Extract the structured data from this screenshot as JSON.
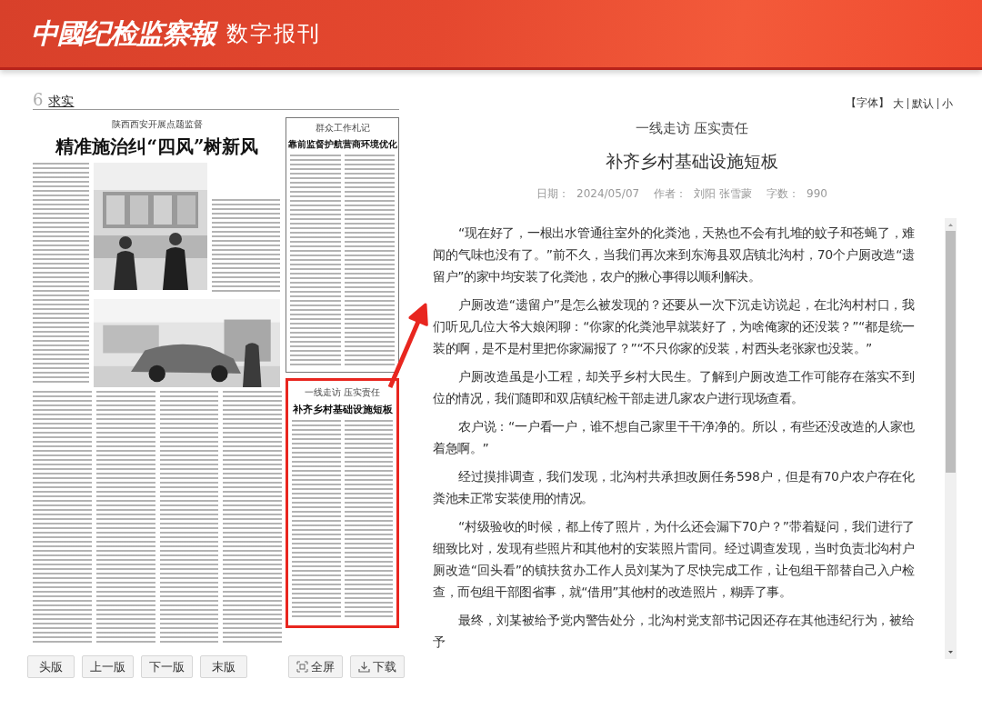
{
  "header": {
    "logo": "中國纪检监察報",
    "subtitle": "数字报刊"
  },
  "newspaper": {
    "page_number": "6",
    "section": "求实",
    "articles": [
      {
        "kicker": "陕西西安开展点题监督",
        "headline": "精准施治纠“四风”树新风",
        "highlighted": false
      },
      {
        "kicker": "群众工作札记",
        "headline": "靠前监督护航营商环境优化",
        "highlighted": false
      },
      {
        "kicker": "一线走访 压实责任",
        "headline": "补齐乡村基础设施短板",
        "highlighted": true
      }
    ]
  },
  "page_nav": [
    "头版",
    "上一版",
    "下一版",
    "末版"
  ],
  "tools": [
    {
      "kind": "fullscreen",
      "label": "全屏"
    },
    {
      "kind": "download",
      "label": "下载"
    }
  ],
  "font_size": {
    "label": "【字体】",
    "options": [
      "大",
      "默认",
      "小"
    ]
  },
  "article": {
    "kicker": "一线走访 压实责任",
    "title": "补齐乡村基础设施短板",
    "meta": [
      {
        "label": "日期：",
        "value": "2024/05/07"
      },
      {
        "label": "作者：",
        "value": "刘阳 张雪蒙"
      },
      {
        "label": "字数：",
        "value": "990"
      }
    ],
    "paragraphs": [
      "“现在好了，一根出水管通往室外的化粪池，天热也不会有扎堆的蚊子和苍蝇了，难闻的气味也没有了。”前不久，当我们再次来到东海县双店镇北沟村，70个户厕改造“遗留户”的家中均安装了化粪池，农户的揪心事得以顺利解决。",
      "户厕改造“遗留户”是怎么被发现的？还要从一次下沉走访说起，在北沟村村口，我们听见几位大爷大娘闲聊：“你家的化粪池早就装好了，为啥俺家的还没装？”“都是统一装的啊，是不是村里把你家漏报了？”“不只你家的没装，村西头老张家也没装。”",
      "户厕改造虽是小工程，却关乎乡村大民生。了解到户厕改造工作可能存在落实不到位的情况，我们随即和双店镇纪检干部走进几家农户进行现场查看。",
      "农户说：“一户看一户，谁不想自己家里干干净净的。所以，有些还没改造的人家也着急啊。”",
      "经过摸排调查，我们发现，北沟村共承担改厕任务598户，但是有70户农户存在化粪池未正常安装使用的情况。",
      "“村级验收的时候，都上传了照片，为什么还会漏下70户？”带着疑问，我们进行了细致比对，发现有些照片和其他村的安装照片雷同。经过调查发现，当时负责北沟村户厕改造“回头看”的镇扶贫办工作人员刘某为了尽快完成工作，让包组干部替自己入户检查，而包组干部图省事，就“借用”其他村的改造照片，糊弄了事。",
      "最终，刘某被给予党内警告处分，北沟村党支部书记因还存在其他违纪行为，被给予"
    ]
  }
}
